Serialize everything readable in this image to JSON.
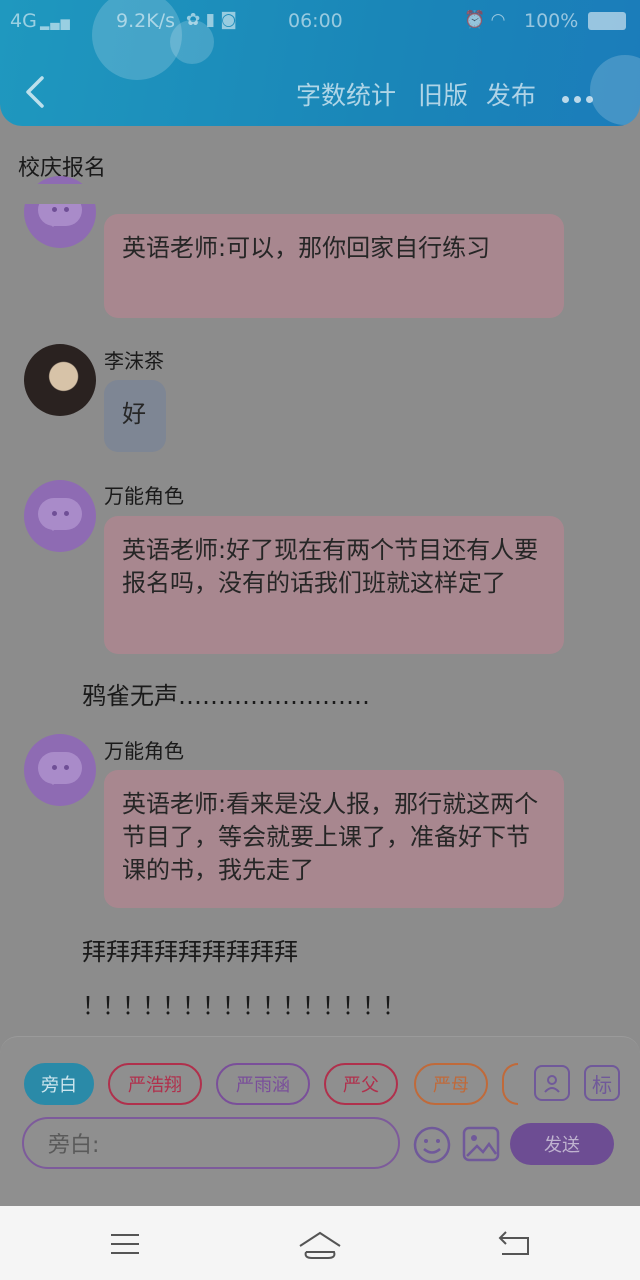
{
  "status_bar": {
    "network": "4G",
    "speed": "9.2K/s",
    "time": "06:00",
    "battery": "100%"
  },
  "toolbar": {
    "word_count": "字数统计",
    "old_version": "旧版",
    "publish": "发布"
  },
  "story_title": "校庆报名",
  "messages": [
    {
      "type": "bubble",
      "text": "英语老师:可以，那你回家自行练习"
    },
    {
      "type": "bubble",
      "speaker": "李沫茶",
      "text": "好"
    },
    {
      "type": "bubble",
      "speaker": "万能角色",
      "text": "英语老师:好了现在有两个节目还有人要报名吗，没有的话我们班就这样定了"
    },
    {
      "type": "narration",
      "text": "鸦雀无声……………………"
    },
    {
      "type": "bubble",
      "speaker": "万能角色",
      "text": "英语老师:看来是没人报，那行就这两个节目了，等会就要上课了，准备好下节课的书，我先走了"
    },
    {
      "type": "narration",
      "text": "拜拜拜拜拜拜拜拜拜"
    },
    {
      "type": "narration",
      "text": "！！！！！！！！！！！！！！！！"
    }
  ],
  "roles": [
    {
      "label": "旁白",
      "color": "#2a8aa8"
    },
    {
      "label": "严浩翔",
      "color": "#b0304c"
    },
    {
      "label": "严雨涵",
      "color": "#7a4f9a"
    },
    {
      "label": "严父",
      "color": "#b0304c"
    },
    {
      "label": "严母",
      "color": "#c06a3a"
    }
  ],
  "role_icons": {
    "character": "character-icon",
    "marker": "标"
  },
  "composer": {
    "placeholder": "旁白:",
    "send_label": "发送"
  },
  "icons": [
    "emoji-icon",
    "image-icon"
  ]
}
